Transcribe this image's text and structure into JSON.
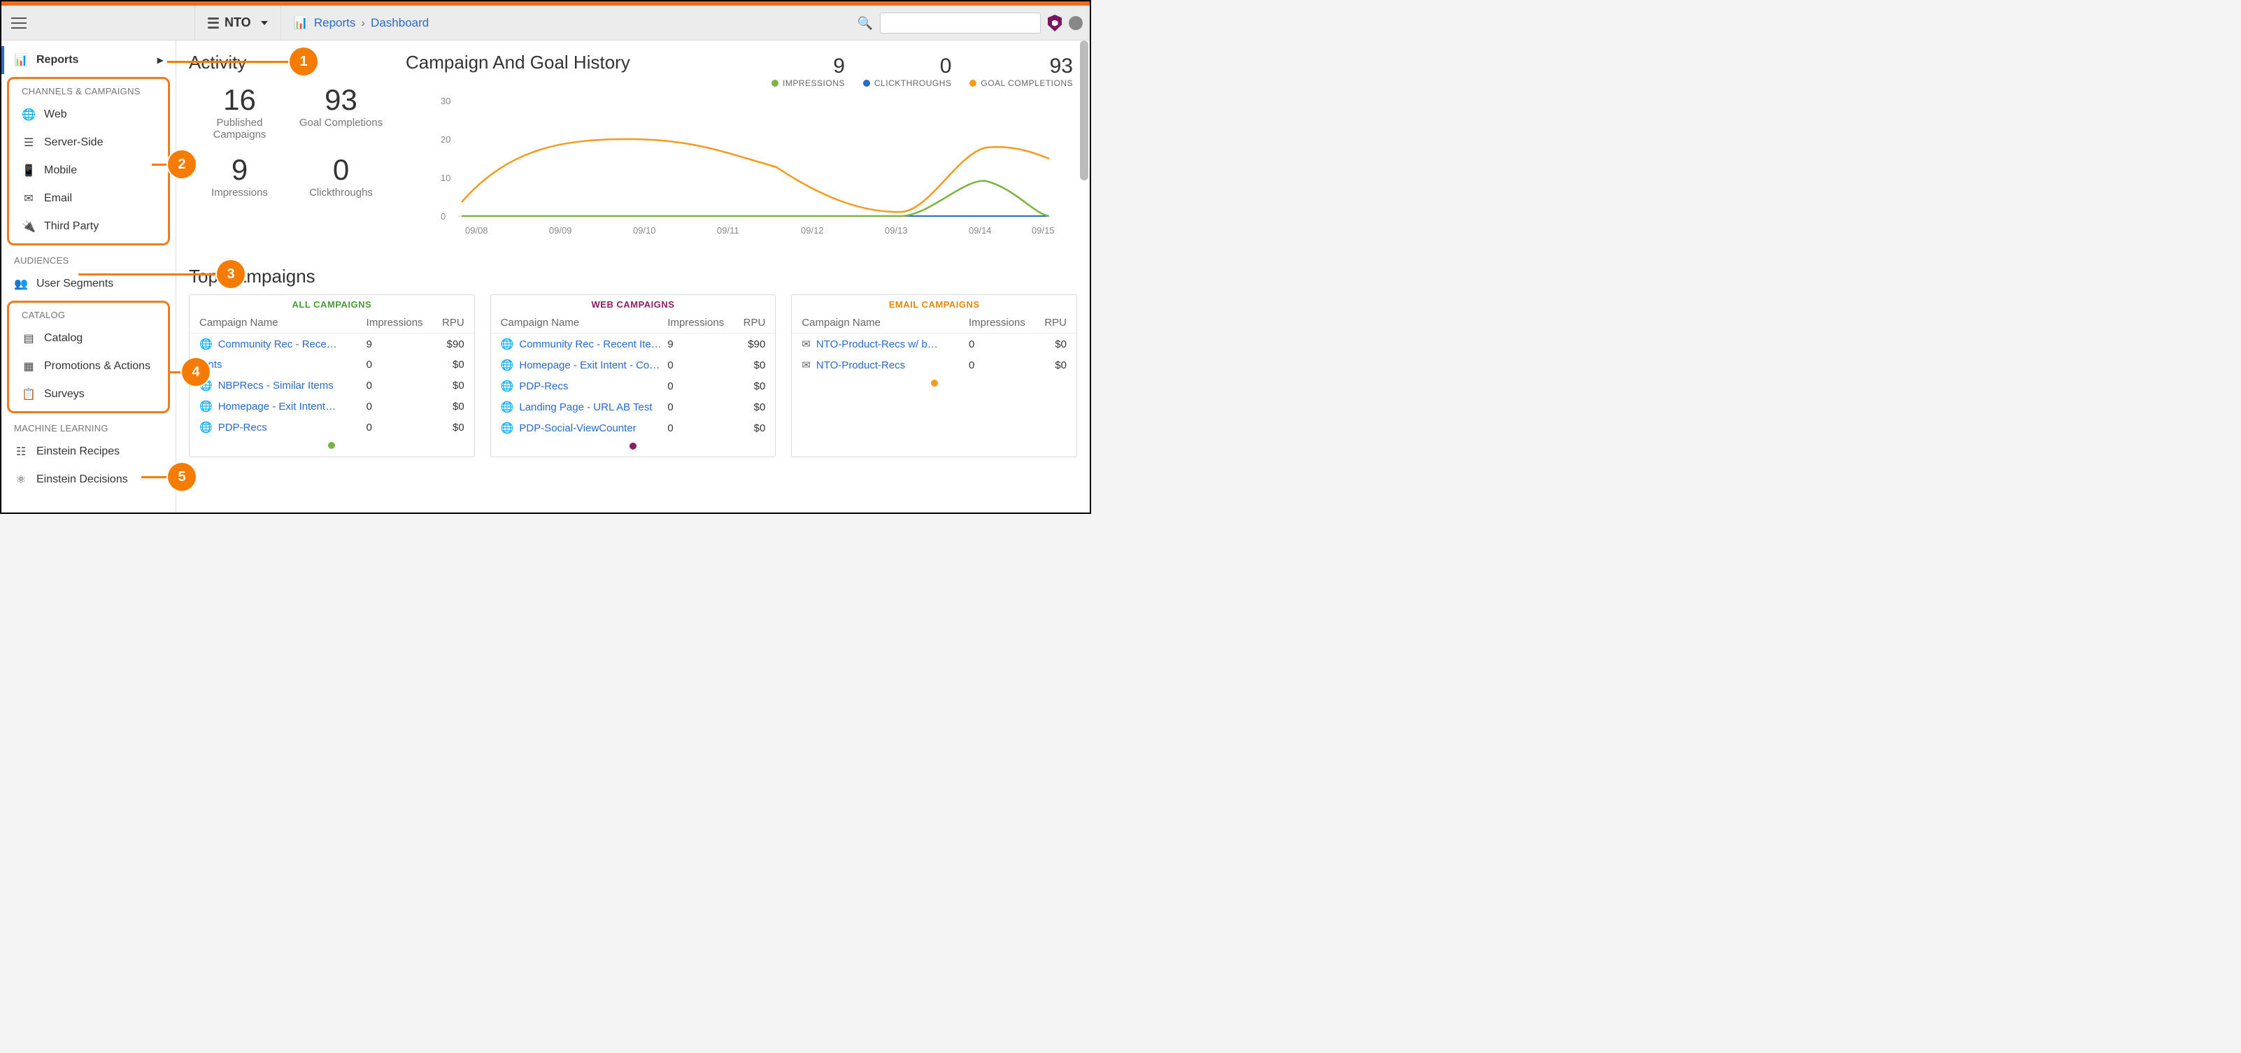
{
  "workspace": {
    "label": "NTO"
  },
  "breadcrumbs": {
    "root": "Reports",
    "leaf": "Dashboard"
  },
  "sidebar": {
    "reports": "Reports",
    "sec_channels": "CHANNELS & CAMPAIGNS",
    "items_channels": [
      "Web",
      "Server-Side",
      "Mobile",
      "Email",
      "Third Party"
    ],
    "sec_aud": "AUDIENCES",
    "aud_item": "User Segments",
    "sec_catalog": "CATALOG",
    "items_catalog": [
      "Catalog",
      "Promotions & Actions",
      "Surveys"
    ],
    "sec_ml": "MACHINE LEARNING",
    "items_ml": [
      "Einstein Recipes",
      "Einstein Decisions"
    ]
  },
  "callouts": {
    "b1": "1",
    "b2": "2",
    "b3": "3",
    "b4": "4",
    "b5": "5"
  },
  "activity": {
    "title": "Activity",
    "pub_n": "16",
    "pub_l": "Published Campaigns",
    "goal_n": "93",
    "goal_l": "Goal Completions",
    "imp_n": "9",
    "imp_l": "Impressions",
    "ct_n": "0",
    "ct_l": "Clickthroughs"
  },
  "history": {
    "title": "Campaign And Goal History",
    "legend": {
      "imp_n": "9",
      "imp_l": "IMPRESSIONS",
      "ct_n": "0",
      "ct_l": "CLICKTHROUGHS",
      "gc_n": "93",
      "gc_l": "GOAL COMPLETIONS"
    },
    "ticks": [
      "09/08",
      "09/09",
      "09/10",
      "09/11",
      "09/12",
      "09/13",
      "09/14",
      "09/15"
    ],
    "yticks": [
      "30",
      "20",
      "10",
      "0"
    ]
  },
  "chart_data": {
    "type": "line",
    "title": "Campaign And Goal History",
    "xlabel": "",
    "ylabel": "",
    "categories": [
      "09/08",
      "09/09",
      "09/10",
      "09/11",
      "09/12",
      "09/13",
      "09/14",
      "09/15"
    ],
    "ylim": [
      0,
      30
    ],
    "series": [
      {
        "name": "IMPRESSIONS",
        "color": "#7cb342",
        "values": [
          0,
          0,
          0,
          0,
          0,
          0,
          9,
          0
        ]
      },
      {
        "name": "CLICKTHROUGHS",
        "color": "#2a6acb",
        "values": [
          0,
          0,
          0,
          0,
          0,
          0,
          0,
          0
        ]
      },
      {
        "name": "GOAL COMPLETIONS",
        "color": "#f39a1f",
        "values": [
          4,
          20,
          20,
          16,
          4,
          2,
          18,
          15
        ]
      }
    ]
  },
  "top": {
    "title": "Top Campaigns",
    "hdr_name": "Campaign Name",
    "hdr_imp": "Impressions",
    "hdr_rpu": "RPU",
    "all": {
      "title": "ALL CAMPAIGNS",
      "rows": [
        {
          "icon": "globe",
          "name": "Community Rec - Rece…",
          "imp": "9",
          "rpu": "$90"
        },
        {
          "icon": "",
          "name": "tents",
          "imp": "0",
          "rpu": "$0"
        },
        {
          "icon": "globe",
          "name": "NBPRecs - Similar Items",
          "imp": "0",
          "rpu": "$0"
        },
        {
          "icon": "globe",
          "name": "Homepage - Exit Intent…",
          "imp": "0",
          "rpu": "$0"
        },
        {
          "icon": "globe",
          "name": "PDP-Recs",
          "imp": "0",
          "rpu": "$0"
        }
      ]
    },
    "web": {
      "title": "WEB CAMPAIGNS",
      "rows": [
        {
          "icon": "globe",
          "name": "Community Rec - Recent Ite…",
          "imp": "9",
          "rpu": "$90"
        },
        {
          "icon": "globe",
          "name": "Homepage - Exit Intent - Co…",
          "imp": "0",
          "rpu": "$0"
        },
        {
          "icon": "globe",
          "name": "PDP-Recs",
          "imp": "0",
          "rpu": "$0"
        },
        {
          "icon": "globe",
          "name": "Landing Page - URL AB Test",
          "imp": "0",
          "rpu": "$0"
        },
        {
          "icon": "globe",
          "name": "PDP-Social-ViewCounter",
          "imp": "0",
          "rpu": "$0"
        }
      ]
    },
    "email": {
      "title": "EMAIL CAMPAIGNS",
      "rows": [
        {
          "icon": "mail",
          "name": "NTO-Product-Recs w/ b…",
          "imp": "0",
          "rpu": "$0"
        },
        {
          "icon": "mail",
          "name": "NTO-Product-Recs",
          "imp": "0",
          "rpu": "$0"
        }
      ]
    }
  }
}
